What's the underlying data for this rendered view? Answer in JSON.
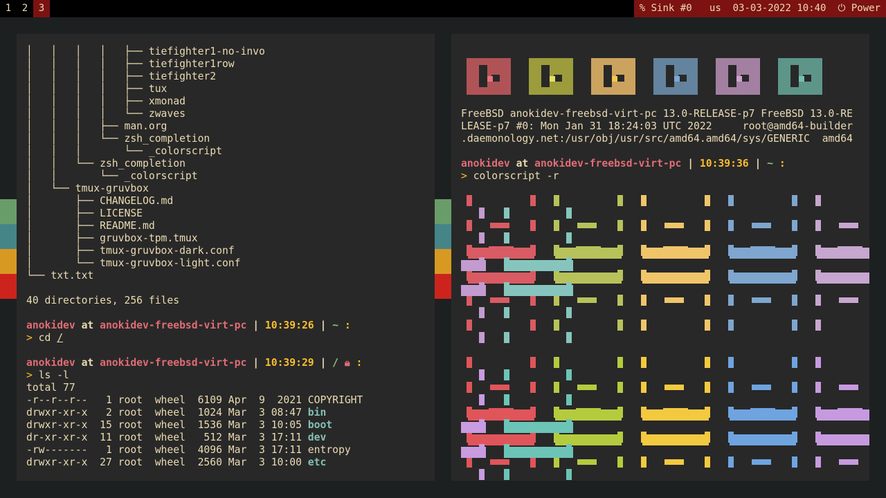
{
  "topbar": {
    "workspaces": [
      {
        "label": "1",
        "active": false
      },
      {
        "label": "2",
        "active": false
      },
      {
        "label": "3",
        "active": true
      }
    ],
    "status": "% Sink #0   us  03-03-2022 10:40  ⏻ Power"
  },
  "colors": {
    "bar_bg": "#000000",
    "accent": "#7c1212",
    "terminal_bg": "#282828",
    "desktop_bg": "#1d2021",
    "strips": [
      "#689d6a",
      "#458588",
      "#d79921",
      "#cc241d"
    ]
  },
  "left_terminal": {
    "tree_lines": [
      "│   │   │   │   ├── tiefighter1-no-invo",
      "│   │   │   │   ├── tiefighter1row",
      "│   │   │   │   ├── tiefighter2",
      "│   │   │   │   ├── tux",
      "│   │   │   │   ├── xmonad",
      "│   │   │   │   └── zwaves",
      "│   │   │   ├── man.org",
      "│   │   │   └── zsh_completion",
      "│   │   │       └── _colorscript",
      "│   │   └── zsh_completion",
      "│   │       └── _colorscript",
      "│   └── tmux-gruvbox",
      "│       ├── CHANGELOG.md",
      "│       ├── LICENSE",
      "│       ├── README.md",
      "│       ├── gruvbox-tpm.tmux",
      "│       ├── tmux-gruvbox-dark.conf",
      "│       └── tmux-gruvbox-light.conf",
      "└── txt.txt"
    ],
    "summary": "40 directories, 256 files",
    "prompt1": {
      "user": "anokidev",
      "at": "at",
      "host": "anokidev-freebsd-virt-pc",
      "sep": "|",
      "time": "10:39:26",
      "path": "~",
      "colon": ":",
      "cmd": "cd /"
    },
    "prompt2": {
      "user": "anokidev",
      "at": "at",
      "host": "anokidev-freebsd-virt-pc",
      "sep": "|",
      "time": "10:39:29",
      "path": "/",
      "lock": "🔒",
      "colon": ":",
      "cmd": "ls -l"
    },
    "total": "total 77",
    "ls_rows": [
      {
        "meta": "-r--r--r--   1 root  wheel  6109 Apr  9  2021 ",
        "name": "COPYRIGHT",
        "is_dir": false
      },
      {
        "meta": "drwxr-xr-x   2 root  wheel  1024 Mar  3 08:47 ",
        "name": "bin",
        "is_dir": true
      },
      {
        "meta": "drwxr-xr-x  15 root  wheel  1536 Mar  3 10:05 ",
        "name": "boot",
        "is_dir": true
      },
      {
        "meta": "dr-xr-xr-x  11 root  wheel   512 Mar  3 17:11 ",
        "name": "dev",
        "is_dir": true
      },
      {
        "meta": "-rw-------   1 root  wheel  4096 Mar  3 17:11 ",
        "name": "entropy",
        "is_dir": false
      },
      {
        "meta": "drwxr-xr-x  27 root  wheel  2560 Mar  3 10:00 ",
        "name": "etc",
        "is_dir": true
      }
    ]
  },
  "right_terminal": {
    "logo_colors": [
      "#c85a5f",
      "#b0b040",
      "#e8b868",
      "#6f93b3",
      "#b88fb6",
      "#67a89a"
    ],
    "uname": [
      "FreeBSD anokidev-freebsd-virt-pc 13.0-RELEASE-p7 FreeBSD 13.0-RE",
      "LEASE-p7 #0: Mon Jan 31 18:24:03 UTC 2022     root@amd64-builder",
      ".daemonology.net:/usr/obj/usr/src/amd64.amd64/sys/GENERIC  amd64"
    ],
    "prompt": {
      "user": "anokidev",
      "at": "at",
      "host": "anokidev-freebsd-virt-pc",
      "sep": "|",
      "time": "10:39:36",
      "path": "~",
      "colon": ":",
      "cmd": "colorscript -r"
    },
    "art_colors_top": [
      "#d95b63",
      "#c39bd0",
      "#86c5bd",
      "#b7c25a",
      "#f0c56a",
      "#7ea6cf",
      "#c7a6cf"
    ],
    "art_colors_bottom": [
      "#e0555a",
      "#c99be0",
      "#6cc4b6",
      "#b5cb3e",
      "#f3c940",
      "#6fa4e0",
      "#c79ae0"
    ]
  }
}
